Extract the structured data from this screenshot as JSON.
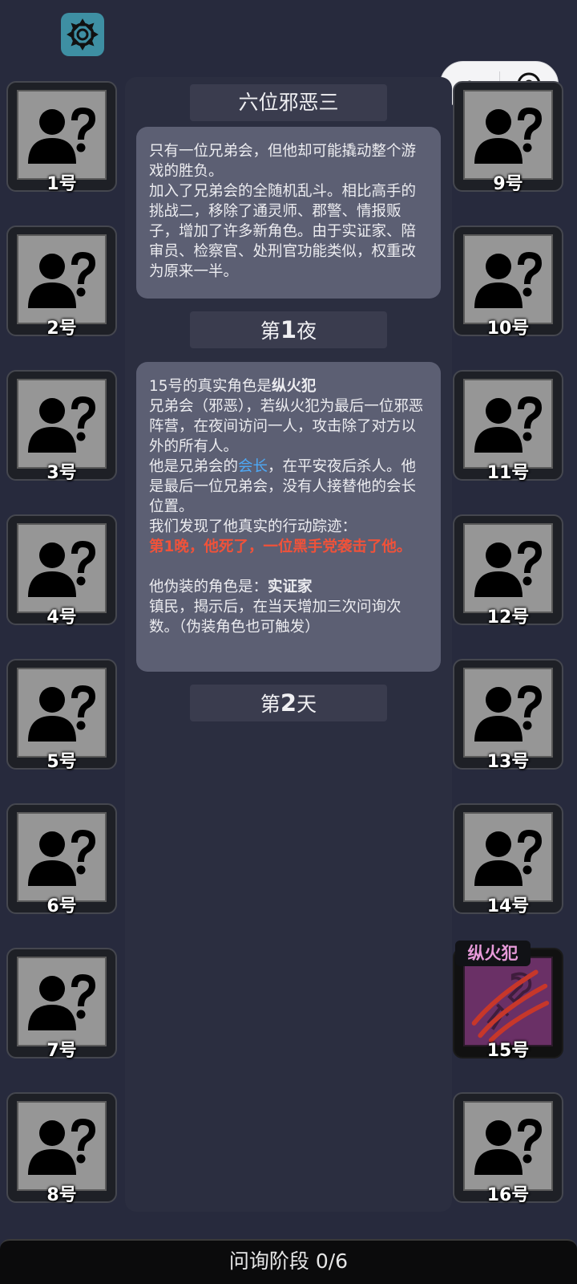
{
  "settings": {
    "icon": "gear-icon",
    "color": "#3e8fa3"
  },
  "capsule": {
    "more_icon": "more-dots-icon",
    "close_icon": "target-circle-icon"
  },
  "players_left": [
    {
      "label": "1号"
    },
    {
      "label": "2号"
    },
    {
      "label": "3号"
    },
    {
      "label": "4号"
    },
    {
      "label": "5号"
    },
    {
      "label": "6号"
    },
    {
      "label": "7号"
    },
    {
      "label": "8号"
    }
  ],
  "players_right": [
    {
      "label": "9号"
    },
    {
      "label": "10号"
    },
    {
      "label": "11号"
    },
    {
      "label": "12号"
    },
    {
      "label": "13号"
    },
    {
      "label": "14号"
    },
    {
      "label": "15号",
      "role": "纵火犯",
      "revealed": true
    },
    {
      "label": "16号"
    }
  ],
  "log": {
    "scenario_title": "六位邪恶三",
    "intro_lines": [
      "只有一位兄弟会，但他却可能撬动整个游戏的胜负。",
      "加入了兄弟会的全随机乱斗。相比高手的挑战二，移除了通灵师、郡警、情报贩子，增加了许多新角色。由于实证家、陪审员、检察官、处刑官功能类似，权重改为原来一半。"
    ],
    "night1": {
      "prefix": "第",
      "num": "1",
      "suffix": "夜"
    },
    "reveal": {
      "line1_prefix": "15号的真实角色是",
      "role_name": "纵火犯",
      "role_desc": "兄弟会（邪恶），若纵火犯为最后一位邪恶阵营，在夜间访问一人，攻击除了对方以外的所有人。",
      "leader_prefix": "他是兄弟会的",
      "leader_word": "会长",
      "leader_suffix": "，在平安夜后杀人。他是最后一位兄弟会，没有人接替他的会长位置。",
      "trace_intro": "我们发现了他真实的行动踪迹：",
      "trace_event": "第1晚，他死了，一位黑手党袭击了他。",
      "disguise_prefix": "他伪装的角色是：",
      "disguise_role": "实证家",
      "disguise_desc": "镇民，揭示后，在当天增加三次问询次数。（伪装角色也可触发）"
    },
    "day2": {
      "prefix": "第",
      "num": "2",
      "suffix": "天"
    }
  },
  "phase": {
    "label": "问询阶段 0/6"
  },
  "colors": {
    "background": "#272a3d",
    "bubble": "#5c5f73",
    "highlight_blue": "#4ea8f5",
    "highlight_red": "#f0523a",
    "role_tag": "#e79ad9",
    "revealed_card": "#6a3066"
  }
}
